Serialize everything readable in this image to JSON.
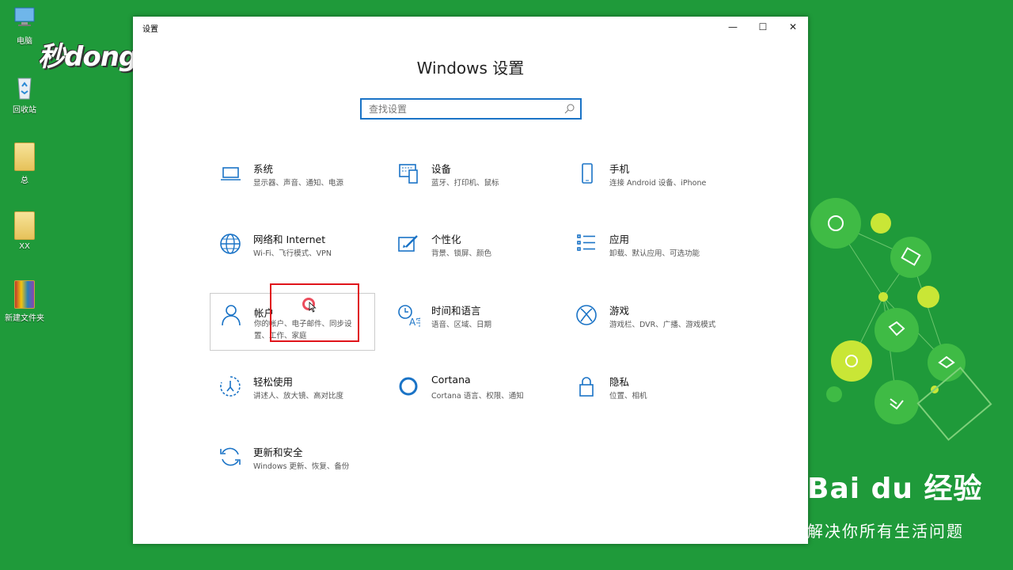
{
  "desktop": {
    "icons": [
      {
        "label": "电脑",
        "icon": "computer-icon"
      },
      {
        "label": "回收站",
        "icon": "recycle-bin-icon"
      },
      {
        "label": "总",
        "icon": "folder-icon"
      },
      {
        "label": "XX",
        "icon": "folder-icon"
      },
      {
        "label": "新建文件夹",
        "icon": "folder-icon"
      }
    ],
    "background_color": "#1f9a3a"
  },
  "watermark": {
    "logo_text": "秒dong视频"
  },
  "window": {
    "title": "设置",
    "controls": {
      "minimize": "—",
      "maximize": "☐",
      "close": "✕"
    },
    "heading": "Windows 设置",
    "search": {
      "placeholder": "查找设置",
      "icon": "search-icon"
    },
    "accent": "#1a73c6",
    "categories": [
      {
        "title": "系统",
        "desc": "显示器、声音、通知、电源",
        "icon": "laptop-icon"
      },
      {
        "title": "设备",
        "desc": "蓝牙、打印机、鼠标",
        "icon": "keyboard-device-icon"
      },
      {
        "title": "手机",
        "desc": "连接 Android 设备、iPhone",
        "icon": "phone-icon"
      },
      {
        "title": "网络和 Internet",
        "desc": "Wi-Fi、飞行模式、VPN",
        "icon": "globe-icon"
      },
      {
        "title": "个性化",
        "desc": "背景、锁屏、颜色",
        "icon": "paint-icon"
      },
      {
        "title": "应用",
        "desc": "卸载、默认应用、可选功能",
        "icon": "apps-list-icon"
      },
      {
        "title": "帐户",
        "desc": "你的帐户、电子邮件、同步设置、工作、家庭",
        "icon": "person-icon"
      },
      {
        "title": "时间和语言",
        "desc": "语音、区域、日期",
        "icon": "time-language-icon"
      },
      {
        "title": "游戏",
        "desc": "游戏栏、DVR、广播、游戏模式",
        "icon": "xbox-icon"
      },
      {
        "title": "轻松使用",
        "desc": "讲述人、放大镜、高对比度",
        "icon": "ease-of-access-icon"
      },
      {
        "title": "Cortana",
        "desc": "Cortana 语言、权限、通知",
        "icon": "cortana-icon"
      },
      {
        "title": "隐私",
        "desc": "位置、相机",
        "icon": "lock-icon"
      },
      {
        "title": "更新和安全",
        "desc": "Windows 更新、恢复、备份",
        "icon": "update-icon"
      }
    ]
  },
  "annotation": {
    "highlight_color": "#e0141b"
  },
  "brand": {
    "name": "Bai du 经验",
    "slogan": "解决你所有生活问题"
  }
}
